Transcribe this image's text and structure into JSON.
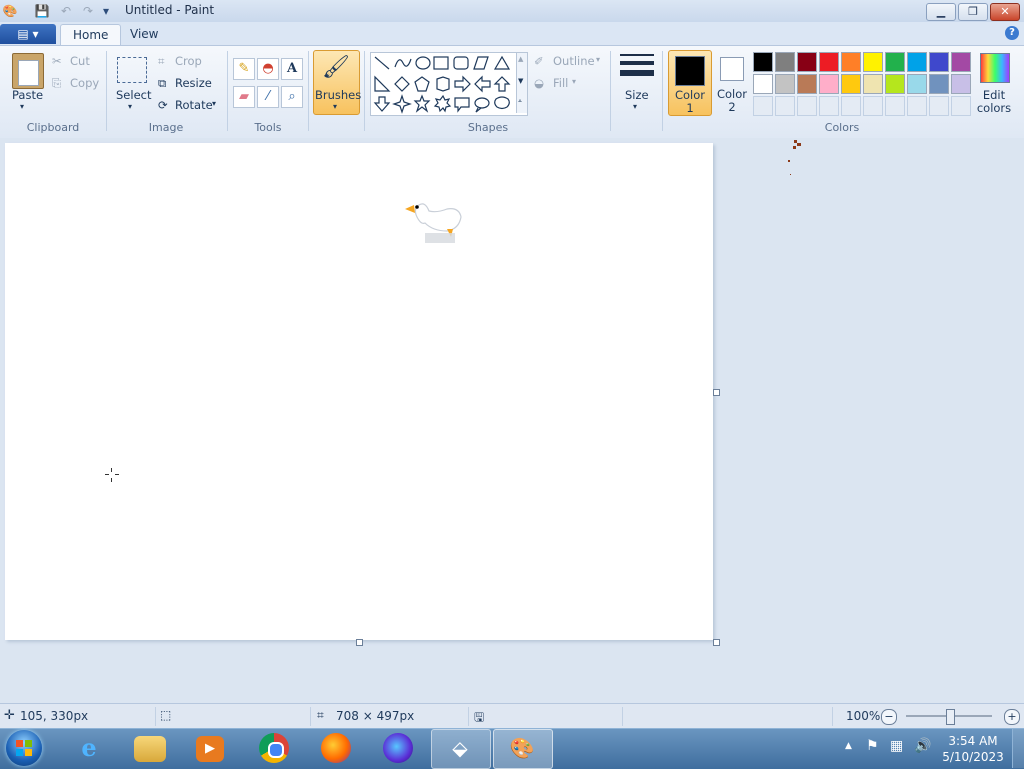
{
  "window": {
    "title": "Untitled - Paint"
  },
  "tabs": {
    "app_menu": "▤ ▾",
    "home": "Home",
    "view": "View"
  },
  "help": "?",
  "ribbon": {
    "clipboard": {
      "group": "Clipboard",
      "paste": "Paste",
      "cut": "Cut",
      "copy": "Copy"
    },
    "image": {
      "group": "Image",
      "select": "Select",
      "crop": "Crop",
      "resize": "Resize",
      "rotate": "Rotate"
    },
    "tools": {
      "group": "Tools"
    },
    "brushes": {
      "label": "Brushes"
    },
    "shapes": {
      "group": "Shapes",
      "outline": "Outline",
      "fill": "Fill"
    },
    "size": {
      "label": "Size"
    },
    "colors": {
      "group": "Colors",
      "color1": [
        "Color",
        "1"
      ],
      "color2": [
        "Color",
        "2"
      ],
      "edit": [
        "Edit",
        "colors"
      ],
      "color1_value": "#000000",
      "color2_value": "#ffffff",
      "row1": [
        "#000000",
        "#7f7f7f",
        "#880015",
        "#ed1c24",
        "#ff7f27",
        "#fff200",
        "#22b14c",
        "#00a2e8",
        "#3f48cc",
        "#a349a4"
      ],
      "row2": [
        "#ffffff",
        "#c3c3c3",
        "#b97a57",
        "#ffaec9",
        "#ffc90e",
        "#efe4b0",
        "#b5e61d",
        "#99d9ea",
        "#7092be",
        "#c8bfe7"
      ]
    }
  },
  "status": {
    "cursor_pos": "105, 330px",
    "canvas_size": "708 × 497px",
    "zoom": "100%"
  },
  "clock": {
    "time": "3:54 AM",
    "date": "5/10/2023"
  }
}
